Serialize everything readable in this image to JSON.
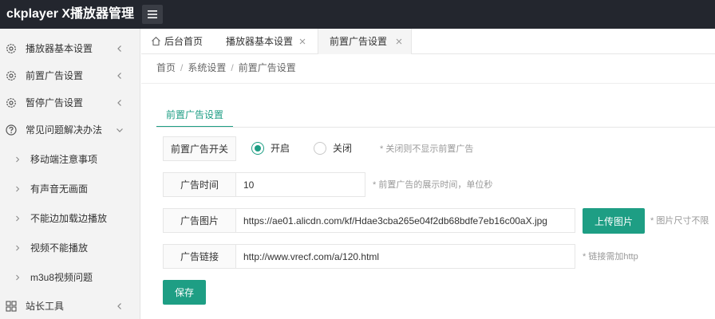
{
  "app": {
    "title": "ckplayer X播放器管理"
  },
  "topbar": {
    "menu_toggle_icon": "hamburger-icon"
  },
  "sidebar": {
    "items": [
      {
        "label": "播放器基本设置",
        "icon": "gear-icon"
      },
      {
        "label": "前置广告设置",
        "icon": "gear-icon"
      },
      {
        "label": "暂停广告设置",
        "icon": "gear-icon"
      },
      {
        "label": "常见问题解决办法",
        "icon": "question-icon",
        "expanded": true
      },
      {
        "label": "移动端注意事项"
      },
      {
        "label": "有声音无画面"
      },
      {
        "label": "不能边加载边播放"
      },
      {
        "label": "视频不能播放"
      },
      {
        "label": "m3u8视频问题"
      },
      {
        "label": "站长工具",
        "icon": "grid-icon"
      }
    ]
  },
  "tabs": [
    {
      "label": "后台首页",
      "icon": "home-icon",
      "closable": false
    },
    {
      "label": "播放器基本设置",
      "closable": true
    },
    {
      "label": "前置广告设置",
      "closable": true,
      "active": true
    }
  ],
  "breadcrumb": [
    "首页",
    "系统设置",
    "前置广告设置"
  ],
  "form": {
    "tab_label": "前置广告设置",
    "switch": {
      "label": "前置广告开关",
      "options": [
        "开启",
        "关闭"
      ],
      "selected": "开启",
      "hint": "* 关闭则不显示前置广告"
    },
    "time": {
      "label": "广告时间",
      "value": "10",
      "hint": "* 前置广告的展示时间，单位秒"
    },
    "image": {
      "label": "广告图片",
      "value": "https://ae01.alicdn.com/kf/Hdae3cba265e04f2db68bdfe7eb16c00aX.jpg",
      "upload_label": "上传图片",
      "hint": "* 图片尺寸不限"
    },
    "link": {
      "label": "广告链接",
      "value": "http://www.vrecf.com/a/120.html",
      "hint": "* 链接需加http"
    },
    "save_label": "保存"
  },
  "colors": {
    "accent": "#1e9e84",
    "topbar": "#23262e",
    "sidebar": "#f3f3f3"
  }
}
